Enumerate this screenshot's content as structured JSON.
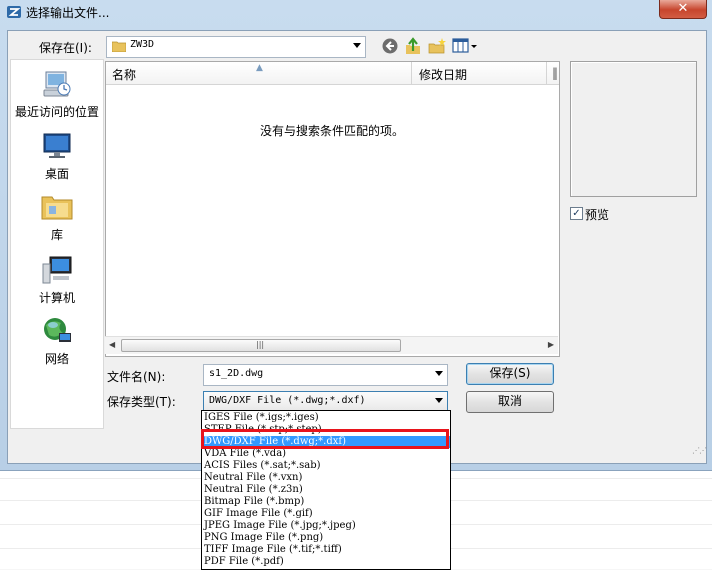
{
  "window": {
    "title": "选择输出文件...",
    "close_label": "✕"
  },
  "toolbar": {
    "save_in_label": "保存在(I):",
    "location": "ZW3D",
    "back_icon": "back-arrow-icon",
    "up_icon": "up-folder-icon",
    "new_folder_icon": "new-folder-icon",
    "views_icon": "view-menu-icon"
  },
  "places": [
    {
      "label": "最近访问的位置",
      "icon": "recent-places-icon"
    },
    {
      "label": "桌面",
      "icon": "desktop-icon"
    },
    {
      "label": "库",
      "icon": "libraries-icon"
    },
    {
      "label": "计算机",
      "icon": "computer-icon"
    },
    {
      "label": "网络",
      "icon": "network-icon"
    }
  ],
  "file_list": {
    "columns": [
      "名称",
      "修改日期",
      "‖"
    ],
    "empty_message": "没有与搜索条件匹配的项。",
    "scroll_grip": "|||"
  },
  "preview": {
    "label": "预览",
    "checked": true
  },
  "form": {
    "filename_label": "文件名(N):",
    "filename_value": "s1_2D.dwg",
    "filetype_label": "保存类型(T):",
    "filetype_value": "DWG/DXF File (*.dwg;*.dxf)",
    "save_button": "保存(S)",
    "cancel_button": "取消"
  },
  "filetype_options": [
    "IGES File (*.igs;*.iges)",
    "STEP File (*.stp;*.step)",
    "DWG/DXF File (*.dwg;*.dxf)",
    "VDA File (*.vda)",
    "ACIS Files (*.sat;*.sab)",
    "Neutral File (*.vxn)",
    "Neutral File (*.z3n)",
    "Bitmap File (*.bmp)",
    "GIF Image File (*.gif)",
    "JPEG Image File (*.jpg;*.jpeg)",
    "PNG Image File (*.png)",
    "TIFF Image File (*.tif;*.tiff)",
    "PDF File (*.pdf)"
  ],
  "selected_option_index": 2,
  "colors": {
    "selection": "#3399ff",
    "annotation_box": "#e8141c"
  }
}
